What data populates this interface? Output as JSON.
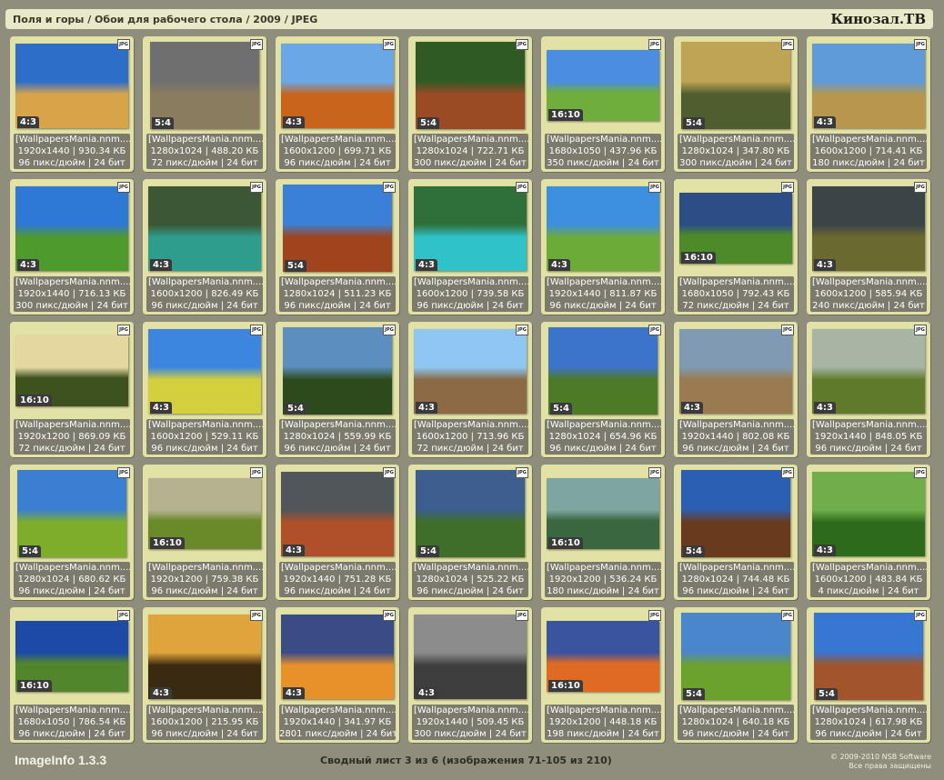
{
  "header": {
    "breadcrumb": "Поля и горы / Обои для рабочего стола / 2009 / JPEG",
    "brand": "Кинозал.ТВ"
  },
  "file_badge": "JPG",
  "items": [
    {
      "file": "[WallpapersMania.nnm....",
      "dims": "1920x1440 | 930.34 КБ",
      "meta": "96 пикс/дюйм | 24 бит",
      "ratio": "4:3",
      "colors": [
        "#2d6ec8",
        "#d9a34a"
      ]
    },
    {
      "file": "[WallpapersMania.nnm....",
      "dims": "1280x1024 | 488.20 КБ",
      "meta": "72 пикс/дюйм | 24 бит",
      "ratio": "5:4",
      "colors": [
        "#6f6f6f",
        "#8a7c5e"
      ]
    },
    {
      "file": "[WallpapersMania.nnm....",
      "dims": "1600x1200 | 699.71 КБ",
      "meta": "96 пикс/дюйм | 24 бит",
      "ratio": "4:3",
      "colors": [
        "#6aa7e6",
        "#c9641c"
      ]
    },
    {
      "file": "[WallpapersMania.nnm....",
      "dims": "1280x1024 | 722.71 КБ",
      "meta": "300 пикс/дюйм | 24 бит",
      "ratio": "5:4",
      "colors": [
        "#2f5a24",
        "#9a4b24"
      ]
    },
    {
      "file": "[WallpapersMania.nnm....",
      "dims": "1680x1050 | 437.96 КБ",
      "meta": "350 пикс/дюйм | 24 бит",
      "ratio": "16:10",
      "colors": [
        "#4a8ee0",
        "#6fae3c"
      ]
    },
    {
      "file": "[WallpapersMania.nnm....",
      "dims": "1280x1024 | 347.80 КБ",
      "meta": "300 пикс/дюйм | 24 бит",
      "ratio": "5:4",
      "colors": [
        "#c0a455",
        "#4f5e2e"
      ]
    },
    {
      "file": "[WallpapersMania.nnm....",
      "dims": "1600x1200 | 714.41 КБ",
      "meta": "180 пикс/дюйм | 24 бит",
      "ratio": "4:3",
      "colors": [
        "#5f9bd8",
        "#b8964e"
      ]
    },
    {
      "file": "[WallpapersMania.nnm....",
      "dims": "1920x1440 | 716.13 КБ",
      "meta": "300 пикс/дюйм | 24 бит",
      "ratio": "4:3",
      "colors": [
        "#2e78d6",
        "#4f9a2c"
      ]
    },
    {
      "file": "[WallpapersMania.nnm....",
      "dims": "1600x1200 | 826.49 КБ",
      "meta": "96 пикс/дюйм | 24 бит",
      "ratio": "4:3",
      "colors": [
        "#3b5736",
        "#2e9d8d"
      ]
    },
    {
      "file": "[WallpapersMania.nnm....",
      "dims": "1280x1024 | 511.23 КБ",
      "meta": "96 пикс/дюйм | 24 бит",
      "ratio": "5:4",
      "colors": [
        "#3b80d8",
        "#a0441e"
      ]
    },
    {
      "file": "[WallpapersMania.nnm....",
      "dims": "1600x1200 | 739.58 КБ",
      "meta": "96 пикс/дюйм | 24 бит",
      "ratio": "4:3",
      "colors": [
        "#2e6f3a",
        "#2fc2c8"
      ]
    },
    {
      "file": "[WallpapersMania.nnm....",
      "dims": "1920x1440 | 811.87 КБ",
      "meta": "96 пикс/дюйм | 24 бит",
      "ratio": "4:3",
      "colors": [
        "#3d8fe0",
        "#6cab38"
      ]
    },
    {
      "file": "[WallpapersMania.nnm....",
      "dims": "1680x1050 | 792.43 КБ",
      "meta": "72 пикс/дюйм | 24 бит",
      "ratio": "16:10",
      "colors": [
        "#2c4d86",
        "#4c8a2a"
      ]
    },
    {
      "file": "[WallpapersMania.nnm....",
      "dims": "1600x1200 | 585.94 КБ",
      "meta": "240 пикс/дюйм | 24 бит",
      "ratio": "4:3",
      "colors": [
        "#3b4446",
        "#6a6a30"
      ]
    },
    {
      "file": "[WallpapersMania.nnm....",
      "dims": "1920x1200 | 869.09 КБ",
      "meta": "72 пикс/дюйм | 24 бит",
      "ratio": "16:10",
      "colors": [
        "#e4d8a0",
        "#3e5220"
      ]
    },
    {
      "file": "[WallpapersMania.nnm....",
      "dims": "1600x1200 | 529.11 КБ",
      "meta": "96 пикс/дюйм | 24 бит",
      "ratio": "4:3",
      "colors": [
        "#3c86df",
        "#d4cf3c"
      ]
    },
    {
      "file": "[WallpapersMania.nnm....",
      "dims": "1280x1024 | 559.99 КБ",
      "meta": "96 пикс/дюйм | 24 бит",
      "ratio": "5:4",
      "colors": [
        "#5c8fc0",
        "#2d4a1c"
      ]
    },
    {
      "file": "[WallpapersMania.nnm....",
      "dims": "1600x1200 | 713.96 КБ",
      "meta": "72 пикс/дюйм | 24 бит",
      "ratio": "4:3",
      "colors": [
        "#8ec8f2",
        "#8c6a46"
      ]
    },
    {
      "file": "[WallpapersMania.nnm....",
      "dims": "1280x1024 | 654.96 КБ",
      "meta": "96 пикс/дюйм | 24 бит",
      "ratio": "5:4",
      "colors": [
        "#3c74cc",
        "#4d7a26"
      ]
    },
    {
      "file": "[WallpapersMania.nnm....",
      "dims": "1920x1440 | 802.08 КБ",
      "meta": "96 пикс/дюйм | 24 бит",
      "ratio": "4:3",
      "colors": [
        "#7f9ab2",
        "#9a7a50"
      ]
    },
    {
      "file": "[WallpapersMania.nnm....",
      "dims": "1920x1440 | 848.05 КБ",
      "meta": "96 пикс/дюйм | 24 бит",
      "ratio": "4:3",
      "colors": [
        "#a8b4a4",
        "#5e7a2a"
      ]
    },
    {
      "file": "[WallpapersMania.nnm....",
      "dims": "1280x1024 | 680.62 КБ",
      "meta": "96 пикс/дюйм | 24 бит",
      "ratio": "5:4",
      "colors": [
        "#3a7fd2",
        "#7cae2c"
      ]
    },
    {
      "file": "[WallpapersMania.nnm....",
      "dims": "1920x1200 | 759.38 КБ",
      "meta": "96 пикс/дюйм | 24 бит",
      "ratio": "16:10",
      "colors": [
        "#b6b290",
        "#6a8a2a"
      ]
    },
    {
      "file": "[WallpapersMania.nnm....",
      "dims": "1920x1440 | 751.28 КБ",
      "meta": "96 пикс/дюйм | 24 бит",
      "ratio": "4:3",
      "colors": [
        "#50565a",
        "#b0502a"
      ]
    },
    {
      "file": "[WallpapersMania.nnm....",
      "dims": "1280x1024 | 525.22 КБ",
      "meta": "96 пикс/дюйм | 24 бит",
      "ratio": "5:4",
      "colors": [
        "#3d5e8e",
        "#3f6e2a"
      ]
    },
    {
      "file": "[WallpapersMania.nnm....",
      "dims": "1920x1200 | 536.24 КБ",
      "meta": "180 пикс/дюйм | 24 бит",
      "ratio": "16:10",
      "colors": [
        "#7fa5a0",
        "#3a6640"
      ]
    },
    {
      "file": "[WallpapersMania.nnm....",
      "dims": "1280x1024 | 744.48 КБ",
      "meta": "96 пикс/дюйм | 24 бит",
      "ratio": "5:4",
      "colors": [
        "#2b5fb3",
        "#6a3a1c"
      ]
    },
    {
      "file": "[WallpapersMania.nnm....",
      "dims": "1600x1200 | 483.84 КБ",
      "meta": "4 пикс/дюйм | 24 бит",
      "ratio": "4:3",
      "colors": [
        "#6fae4a",
        "#2e6a1c"
      ]
    },
    {
      "file": "[WallpapersMania.nnm....",
      "dims": "1680x1050 | 786.54 КБ",
      "meta": "96 пикс/дюйм | 24 бит",
      "ratio": "16:10",
      "colors": [
        "#1c4aa6",
        "#52862c"
      ]
    },
    {
      "file": "[WallpapersMania.nnm....",
      "dims": "1600x1200 | 215.95 КБ",
      "meta": "96 пикс/дюйм | 24 бит",
      "ratio": "4:3",
      "colors": [
        "#e0a43c",
        "#3a2a12"
      ]
    },
    {
      "file": "[WallpapersMania.nnm....",
      "dims": "1920x1440 | 341.97 КБ",
      "meta": "2801 пикс/дюйм | 24 бит",
      "ratio": "4:3",
      "colors": [
        "#3a4c86",
        "#e8902a"
      ]
    },
    {
      "file": "[WallpapersMania.nnm....",
      "dims": "1920x1440 | 509.45 КБ",
      "meta": "300 пикс/дюйм | 24 бит",
      "ratio": "4:3",
      "colors": [
        "#8c8c8c",
        "#3e3e3e"
      ]
    },
    {
      "file": "[WallpapersMania.nnm....",
      "dims": "1920x1200 | 448.18 КБ",
      "meta": "198 пикс/дюйм | 24 бит",
      "ratio": "16:10",
      "colors": [
        "#3a54a0",
        "#e06a24"
      ]
    },
    {
      "file": "[WallpapersMania.nnm....",
      "dims": "1280x1024 | 640.18 КБ",
      "meta": "96 пикс/дюйм | 24 бит",
      "ratio": "5:4",
      "colors": [
        "#4a86cc",
        "#6aa22c"
      ]
    },
    {
      "file": "[WallpapersMania.nnm....",
      "dims": "1280x1024 | 617.98 КБ",
      "meta": "96 пикс/дюйм | 24 бит",
      "ratio": "5:4",
      "colors": [
        "#3776d2",
        "#a2542c"
      ]
    }
  ],
  "footer": {
    "app_name": "ImageInfo 1.3.3",
    "summary": "Сводный лист 3 из 6 (изображения 71-105 из 210)",
    "copyright": "© 2009-2010 NSB Software",
    "rights": "Все права защищены"
  }
}
